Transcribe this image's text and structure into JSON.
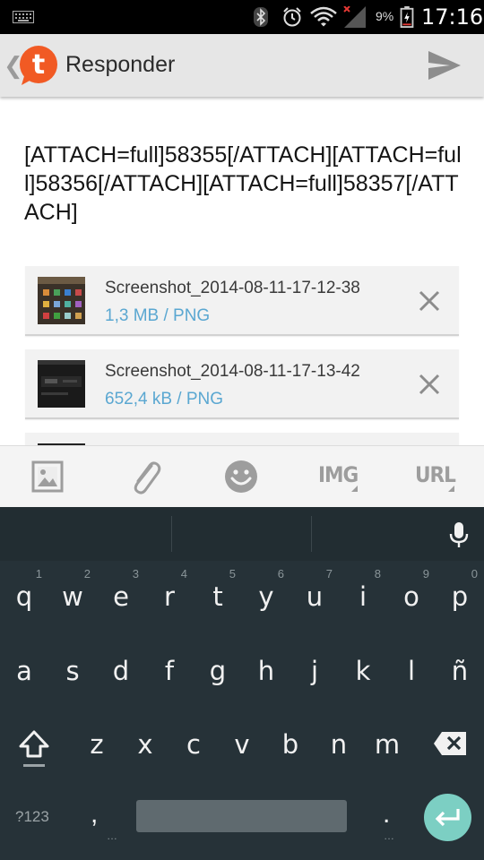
{
  "status_bar": {
    "battery_percent": "9%",
    "time": "17:16",
    "icons": [
      "keyboard-icon",
      "bluetooth-icon",
      "alarm-icon",
      "wifi-icon",
      "signal-icon",
      "battery-icon"
    ]
  },
  "app_bar": {
    "title": "Responder",
    "back_icon": "back-chevron-icon",
    "logo_letter": "t",
    "send_icon": "send-icon",
    "brand_color": "#f15a24"
  },
  "message": {
    "text": "[ATTACH=full]58355[/ATTACH][ATTACH=full]58356[/ATTACH][ATTACH=full]58357[/ATTACH]"
  },
  "attachments": [
    {
      "name": "Screenshot_2014-08-11-17-12-38",
      "meta": "1,3 MB / PNG"
    },
    {
      "name": "Screenshot_2014-08-11-17-13-42",
      "meta": "652,4 kB / PNG"
    }
  ],
  "format_toolbar": {
    "image_icon": "image-icon",
    "attach_icon": "paperclip-icon",
    "emoji_icon": "smiley-icon",
    "img_label": "IMG",
    "url_label": "URL"
  },
  "keyboard": {
    "row1": [
      {
        "ch": "q",
        "hint": "1"
      },
      {
        "ch": "w",
        "hint": "2"
      },
      {
        "ch": "e",
        "hint": "3"
      },
      {
        "ch": "r",
        "hint": "4"
      },
      {
        "ch": "t",
        "hint": "5"
      },
      {
        "ch": "y",
        "hint": "6"
      },
      {
        "ch": "u",
        "hint": "7"
      },
      {
        "ch": "i",
        "hint": "8"
      },
      {
        "ch": "o",
        "hint": "9"
      },
      {
        "ch": "p",
        "hint": "0"
      }
    ],
    "row2": [
      "a",
      "s",
      "d",
      "f",
      "g",
      "h",
      "j",
      "k",
      "l",
      "ñ"
    ],
    "row3": [
      "z",
      "x",
      "c",
      "v",
      "b",
      "n",
      "m"
    ],
    "symbols_label": "?123",
    "comma": ",",
    "period": ".",
    "enter_color": "#7ccfc3"
  }
}
